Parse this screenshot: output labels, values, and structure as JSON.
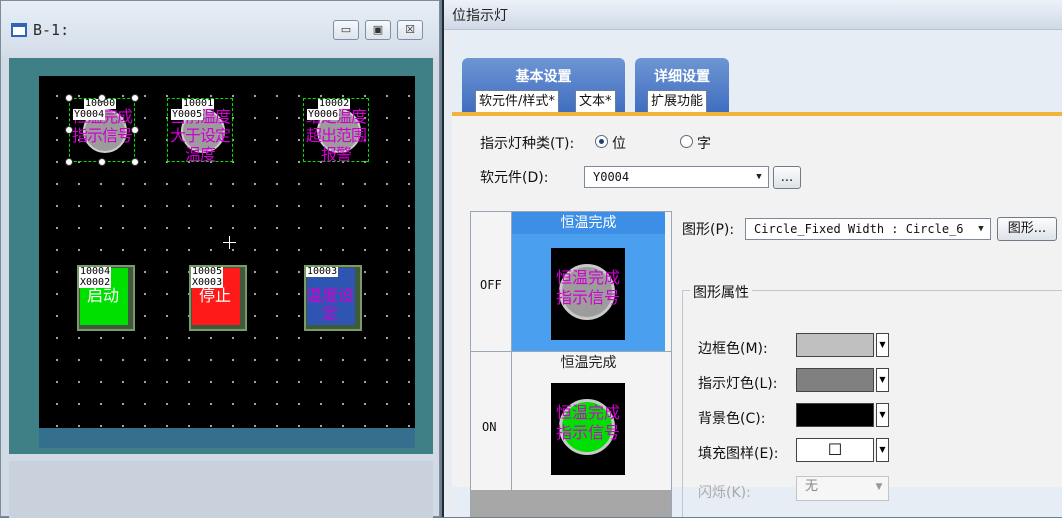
{
  "left_window": {
    "title": "B-1:",
    "buttons": {
      "minimize": "▭",
      "maximize": "▣",
      "close": "☒"
    },
    "lamps": [
      {
        "number": "10000",
        "device": "Y0004",
        "text": "恒温完成指示信号"
      },
      {
        "number": "10001",
        "device": "Y0005",
        "text": "当前温度大于设定温度"
      },
      {
        "number": "10002",
        "device": "Y0006",
        "text": "给定温度超出范围报警"
      }
    ],
    "switches": [
      {
        "number": "10004",
        "device": "X0002",
        "text": "启动",
        "color": "#00e000"
      },
      {
        "number": "10005",
        "device": "X0003",
        "text": "停止",
        "color": "#ff1a1a"
      },
      {
        "number": "10003",
        "device": "",
        "text": "温度设定",
        "color": "#2f55b3"
      }
    ]
  },
  "dialog": {
    "title": "位指示灯",
    "tab_groups": [
      {
        "label": "基本设置",
        "tabs": [
          "软元件/样式*",
          "文本*"
        ]
      },
      {
        "label": "详细设置",
        "tabs": [
          "扩展功能"
        ]
      }
    ],
    "lamp_type": {
      "label": "指示灯种类(T):",
      "option_bit": "位",
      "option_word": "字",
      "selected": "位"
    },
    "device": {
      "label": "软元件(D):",
      "value": "Y0004",
      "browse_button": "..."
    },
    "shape": {
      "label": "图形(P):",
      "value": "Circle_Fixed Width : Circle_6",
      "button": "图形..."
    },
    "preview": {
      "off": {
        "row_label": "OFF",
        "header": "恒温完成",
        "image_text": "恒温完成指示信号",
        "lamp_color": "#9c9c9c"
      },
      "on": {
        "row_label": "ON",
        "header": "恒温完成",
        "image_text": "恒温完成指示信号",
        "lamp_color": "#00e000"
      }
    },
    "properties": {
      "title": "图形属性",
      "border_color": {
        "label": "边框色(M):",
        "color": "#c0c0c0"
      },
      "lamp_color": {
        "label": "指示灯色(L):",
        "color": "#808080"
      },
      "bg_color": {
        "label": "背景色(C):",
        "color": "#000000"
      },
      "fill_pattern": {
        "label": "填充图样(E):",
        "symbol": "☐"
      },
      "blink": {
        "label": "闪烁(K):",
        "value": "无"
      }
    }
  }
}
